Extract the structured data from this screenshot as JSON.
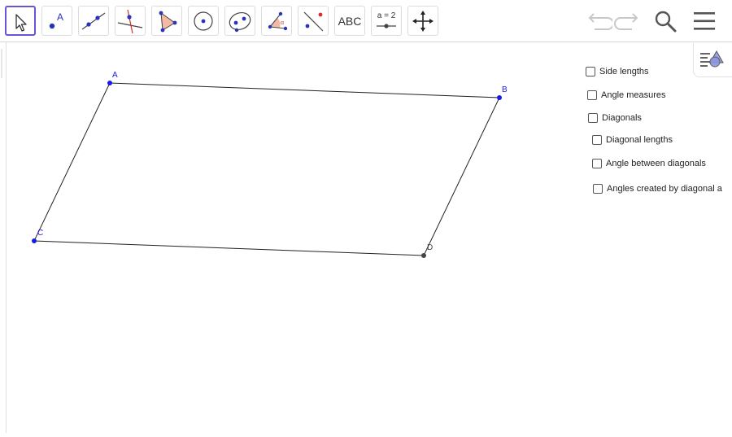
{
  "toolbar": {
    "tools": [
      {
        "name": "move",
        "icon": "arrow-cursor-icon",
        "selected": true
      },
      {
        "name": "point",
        "icon": "point-icon"
      },
      {
        "name": "line",
        "icon": "line-icon"
      },
      {
        "name": "perpendicular-line",
        "icon": "perpendicular-line-icon"
      },
      {
        "name": "polygon",
        "icon": "polygon-icon"
      },
      {
        "name": "circle",
        "icon": "circle-icon"
      },
      {
        "name": "conic",
        "icon": "ellipse-icon"
      },
      {
        "name": "angle",
        "icon": "angle-icon"
      },
      {
        "name": "reflect",
        "icon": "reflect-icon"
      },
      {
        "name": "text",
        "icon": "text-icon",
        "label": "ABC"
      },
      {
        "name": "slider",
        "icon": "slider-icon",
        "label": "a = 2"
      },
      {
        "name": "move-graphics",
        "icon": "move-graphics-icon"
      }
    ],
    "undo_icon": "undo-icon",
    "redo_icon": "redo-icon",
    "search_icon": "search-icon",
    "menu_icon": "menu-icon"
  },
  "points": {
    "A": {
      "label": "A"
    },
    "B": {
      "label": "B"
    },
    "C": {
      "label": "C"
    },
    "D": {
      "label": "D"
    }
  },
  "checkboxes": [
    {
      "label": "Side lengths",
      "checked": false
    },
    {
      "label": "Angle measures",
      "checked": false
    },
    {
      "label": "Diagonals",
      "checked": false
    },
    {
      "label": "Diagonal lengths",
      "checked": false
    },
    {
      "label": "Angle between diagonals",
      "checked": false
    },
    {
      "label": "Angles created by diagonal a",
      "checked": false
    }
  ],
  "style_bar": {
    "icon": "style-bar-icon"
  },
  "colors": {
    "accent": "#6557d2",
    "point_blue": "#1a1ae6",
    "point_dark": "#444444",
    "icon_red": "#d32f2f",
    "polygon_fill": "#f4b9a6"
  }
}
